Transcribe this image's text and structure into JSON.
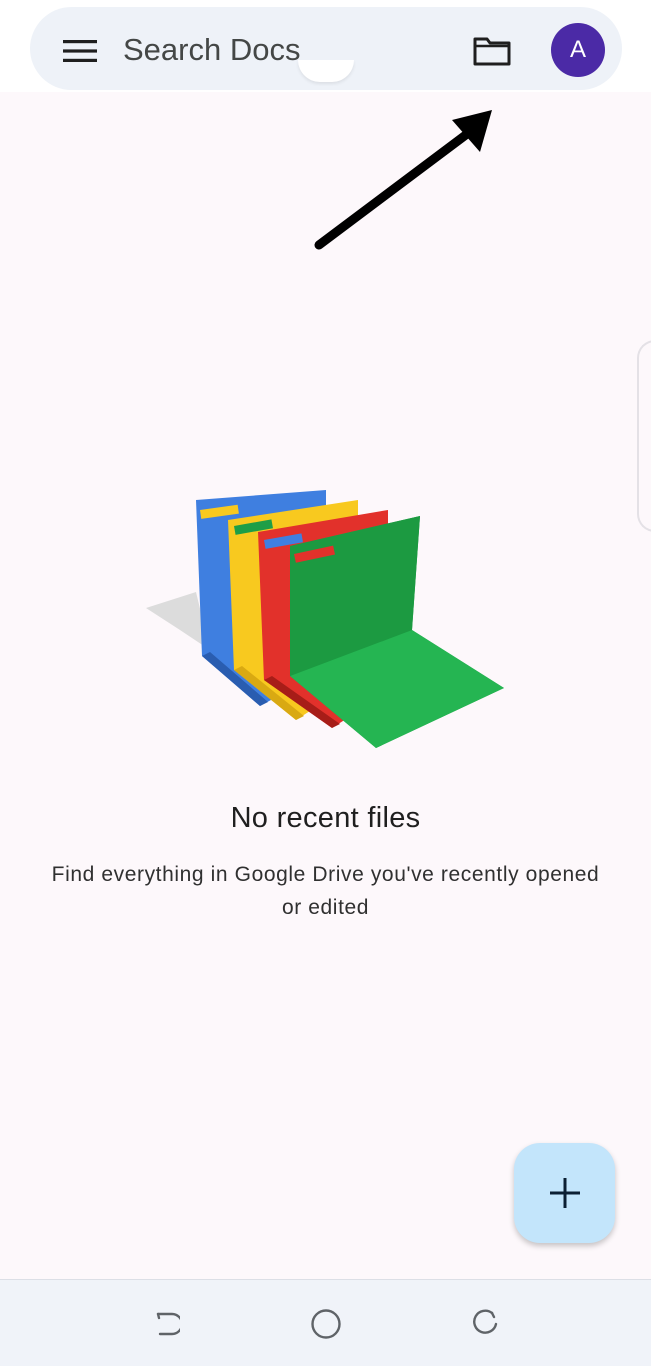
{
  "search": {
    "placeholder": "Search Docs",
    "avatar_letter": "A",
    "avatar_color": "#4b2aa6"
  },
  "icons": {
    "menu": "hamburger-menu-icon",
    "folder": "folder-icon",
    "annotation": "arrow-icon",
    "add": "plus-icon",
    "nav_back": "back-icon",
    "nav_home": "home-icon",
    "nav_recents": "recents-icon"
  },
  "empty_state": {
    "title": "No recent files",
    "description": "Find everything in Google Drive you've recently opened or edited"
  },
  "colors": {
    "fab_background": "#c3e5fb",
    "folder_blue": "#3f7fe0",
    "folder_yellow": "#f8c91f",
    "folder_red": "#e2312b",
    "folder_green": "#1ea446"
  }
}
